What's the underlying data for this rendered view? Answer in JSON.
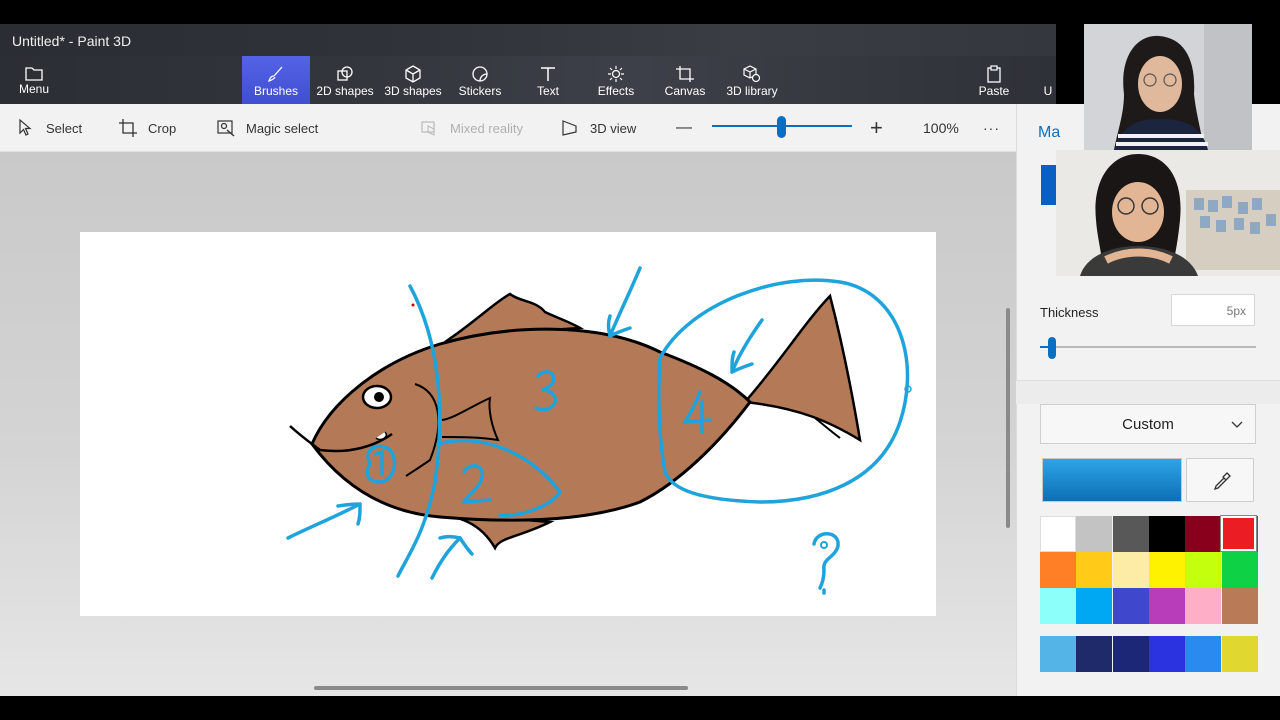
{
  "window": {
    "title": "Untitled* - Paint 3D"
  },
  "ribbon": {
    "menu_label": "Menu",
    "tools": [
      {
        "label": "Brushes",
        "icon": "brush-icon",
        "active": true
      },
      {
        "label": "2D shapes",
        "icon": "2d-shapes-icon"
      },
      {
        "label": "3D shapes",
        "icon": "3d-shapes-icon"
      },
      {
        "label": "Stickers",
        "icon": "stickers-icon"
      },
      {
        "label": "Text",
        "icon": "text-icon"
      },
      {
        "label": "Effects",
        "icon": "effects-icon"
      },
      {
        "label": "Canvas",
        "icon": "canvas-icon"
      },
      {
        "label": "3D library",
        "icon": "3d-library-icon"
      }
    ],
    "paste_label": "Paste",
    "partial_label": "U"
  },
  "toolbar": {
    "select_label": "Select",
    "crop_label": "Crop",
    "magic_select_label": "Magic select",
    "mixed_reality_label": "Mixed reality",
    "view_3d_label": "3D view",
    "zoom_level": "100%",
    "zoom_out_symbol": "—",
    "zoom_in_symbol": "+",
    "more_symbol": "···"
  },
  "panel": {
    "header_partial": "Ma",
    "thickness_label": "Thickness",
    "thickness_value": "5px",
    "thickness_level": 0.05,
    "color_mode": "Custom",
    "current_color": "#1a8ad4",
    "palette_rows": [
      [
        "#ffffff",
        "#c3c3c3",
        "#585858",
        "#000000",
        "#88001b",
        "#ec1c24"
      ],
      [
        "#ff7f27",
        "#ffca18",
        "#fdeca6",
        "#fff200",
        "#c4ff0e",
        "#0ed145"
      ],
      [
        "#8cfffb",
        "#00a8f3",
        "#3f48cc",
        "#b83dba",
        "#ffaec8",
        "#b97a57"
      ]
    ],
    "custom_row": [
      "#54b4e8",
      "#1e2a6a",
      "#1c2778",
      "#2b32e0",
      "#2a8af0",
      "#e0d830"
    ]
  },
  "drawing": {
    "fish_color": "#b47a57",
    "annotation_color": "#1fa3dc",
    "labels": [
      "1",
      "2",
      "3",
      "4",
      "?"
    ]
  }
}
